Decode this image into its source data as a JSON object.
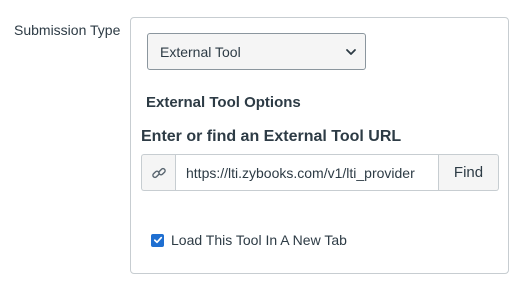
{
  "submission_type": {
    "label": "Submission Type",
    "selected": "External Tool"
  },
  "external_tool": {
    "options_title": "External Tool Options",
    "url_label": "Enter or find an External Tool URL",
    "url_value": "https://lti.zybooks.com/v1/lti_provider",
    "find_label": "Find",
    "new_tab_label": "Load This Tool In A New Tab",
    "new_tab_checked": true
  },
  "colors": {
    "checkbox": "#1f6fd1",
    "border": "#c7cdd1",
    "text": "#2d3b45"
  },
  "icons": [
    "link-icon",
    "chevron-down-icon",
    "checkmark-icon"
  ]
}
